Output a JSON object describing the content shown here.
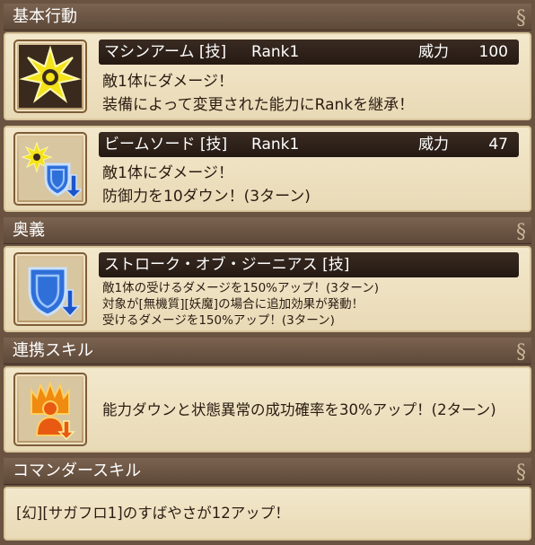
{
  "sections": {
    "basic": "基本行動",
    "ougi": "奥義",
    "renkei": "連携スキル",
    "commander": "コマンダースキル"
  },
  "skills": [
    {
      "name": "マシンアーム [技]",
      "rank": "Rank1",
      "power_label": "威力",
      "power": "100",
      "lines": [
        "敵1体にダメージ！",
        "装備によって変更された能力にRankを継承！"
      ],
      "icon": "machine-arm-burst-icon"
    },
    {
      "name": "ビームソード [技]",
      "rank": "Rank1",
      "power_label": "威力",
      "power": "47",
      "lines": [
        "敵1体にダメージ！",
        "防御力を10ダウン！(3ターン)"
      ],
      "icon": "beam-sword-shield-down-icon"
    }
  ],
  "ougi": {
    "name": "ストローク・オブ・ジーニアス [技]",
    "lines": [
      "敵1体の受けるダメージを150%アップ！(3ターン)",
      "対象が[無機質][妖魔]の場合に追加効果が発動！",
      "受けるダメージを150%アップ！(3ターン)"
    ],
    "icon": "shield-down-icon"
  },
  "renkei": {
    "text": "能力ダウンと状態異常の成功確率を30%アップ！(2ターン)",
    "icon": "flame-figure-icon"
  },
  "commander": {
    "text": "[幻][サガフロ1]のすばやさが12アップ！"
  },
  "colors": {
    "header_bg": "#6a5340",
    "panel_bg": "#f0e4c6",
    "namebar_bg": "#2e2119",
    "icon_yellow": "#f4e21a",
    "icon_blue": "#2f6fd8",
    "icon_orange": "#e85a12"
  }
}
